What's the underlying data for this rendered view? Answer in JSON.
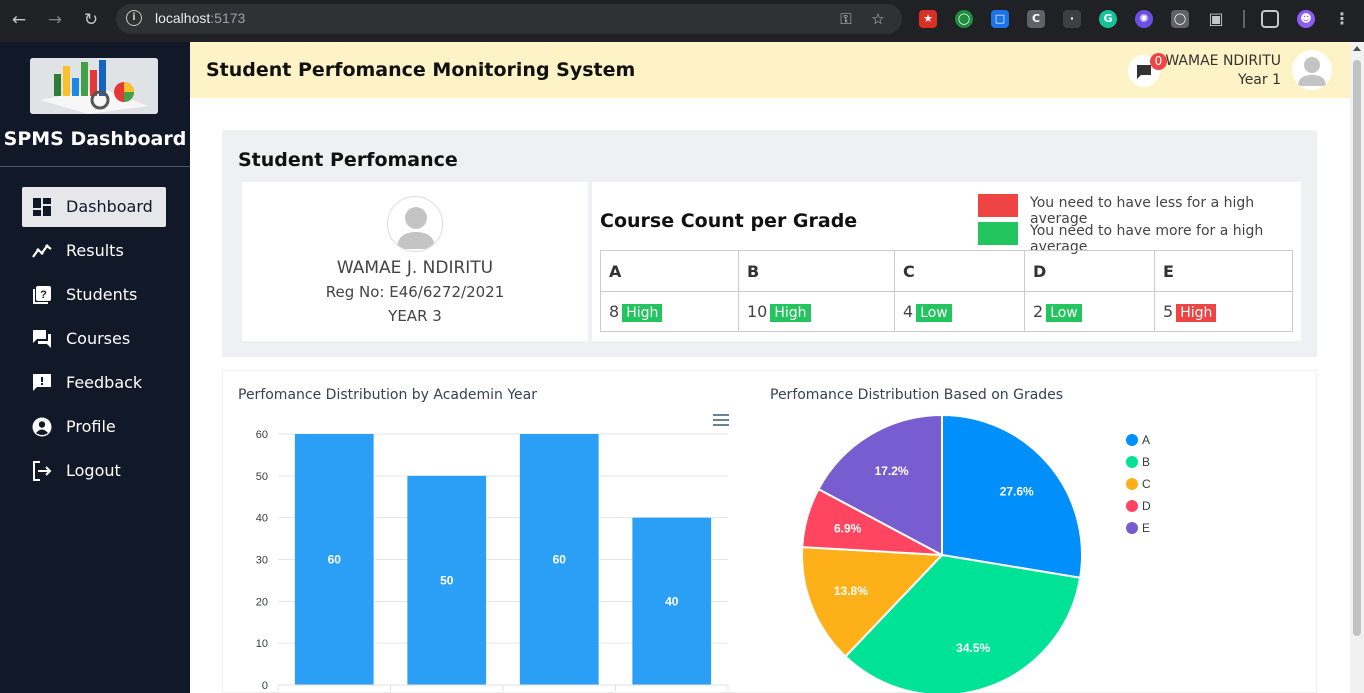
{
  "browser": {
    "url_host": "localhost",
    "url_port": ":5173"
  },
  "sidebar": {
    "brand": "SPMS Dashboard",
    "items": [
      {
        "label": "Dashboard",
        "icon": "dashboard-icon",
        "active": true
      },
      {
        "label": "Results",
        "icon": "chart-line-icon"
      },
      {
        "label": "Students",
        "icon": "student-help-icon"
      },
      {
        "label": "Courses",
        "icon": "chat-icon"
      },
      {
        "label": "Feedback",
        "icon": "feedback-icon"
      },
      {
        "label": "Profile",
        "icon": "user-circle-icon"
      },
      {
        "label": "Logout",
        "icon": "logout-icon"
      }
    ]
  },
  "header": {
    "title": "Student Perfomance Monitoring System",
    "message_count": "0",
    "user_name": "WAMAE NDIRITU",
    "user_year": "Year 1"
  },
  "performance": {
    "title": "Student Perfomance",
    "student_name": "WAMAE J. NDIRITU",
    "reg_no": "Reg No: E46/6272/2021",
    "year": "YEAR 3",
    "grade_title": "Course Count per Grade",
    "legend": [
      {
        "color": "#ef4444",
        "text": "You need to have less for a high average"
      },
      {
        "color": "#22c55e",
        "text": "You need to have more for a high average"
      }
    ],
    "grades": [
      {
        "grade": "A",
        "count": "8",
        "status": "High",
        "status_color": "#22c55e"
      },
      {
        "grade": "B",
        "count": "10",
        "status": "High",
        "status_color": "#22c55e"
      },
      {
        "grade": "C",
        "count": "4",
        "status": "Low",
        "status_color": "#22c55e"
      },
      {
        "grade": "D",
        "count": "2",
        "status": "Low",
        "status_color": "#22c55e"
      },
      {
        "grade": "E",
        "count": "5",
        "status": "High",
        "status_color": "#ef4444"
      }
    ]
  },
  "chart_data": [
    {
      "type": "bar",
      "title": "Perfomance Distribution by Academin Year",
      "categories": [
        "",
        "",
        "",
        ""
      ],
      "values": [
        60,
        50,
        60,
        40
      ],
      "ylim": [
        0,
        60
      ],
      "yticks": [
        0,
        10,
        20,
        30,
        40,
        50,
        60
      ],
      "color": "#2b9ff6",
      "grid": true
    },
    {
      "type": "pie",
      "title": "Perfomance Distribution Based on Grades",
      "labels": [
        "A",
        "B",
        "C",
        "D",
        "E"
      ],
      "values": [
        27.6,
        34.5,
        13.8,
        6.9,
        17.2
      ],
      "colors": [
        "#008ffb",
        "#00e396",
        "#feb019",
        "#ff4560",
        "#775dd0"
      ],
      "legend_position": "right"
    }
  ]
}
